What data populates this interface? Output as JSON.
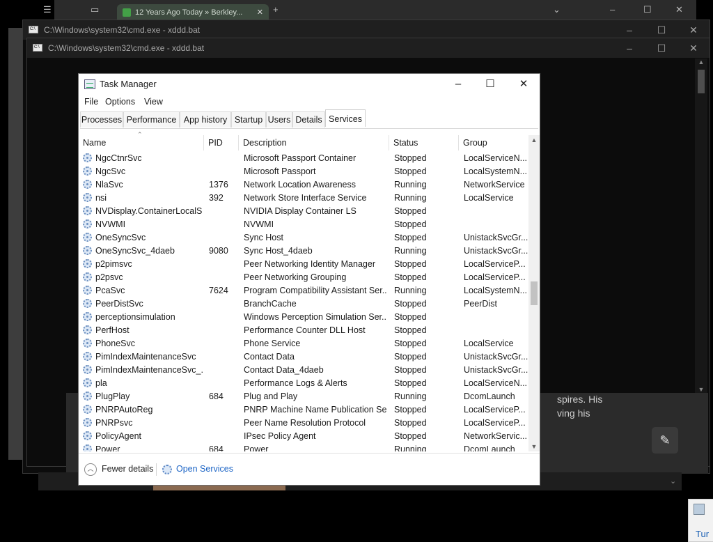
{
  "browser": {
    "tab_title": "12 Years Ago Today » Berkley...",
    "tab_close": "✕"
  },
  "cmd_window_1": {
    "title": "C:\\Windows\\system32\\cmd.exe - xddd.bat"
  },
  "cmd_window_2": {
    "title": "C:\\Windows\\system32\\cmd.exe - xddd.bat"
  },
  "web_content": {
    "line1": "spires. His",
    "line2": "ving his"
  },
  "corner_window": {
    "text": "Tur"
  },
  "task_manager": {
    "title": "Task Manager",
    "menu": [
      "File",
      "Options",
      "View"
    ],
    "tabs": [
      "Processes",
      "Performance",
      "App history",
      "Startup",
      "Users",
      "Details",
      "Services"
    ],
    "active_tab": "Services",
    "columns": [
      "Name",
      "PID",
      "Description",
      "Status",
      "Group"
    ],
    "rows": [
      [
        "NgcCtnrSvc",
        "",
        "Microsoft Passport Container",
        "Stopped",
        "LocalServiceN..."
      ],
      [
        "NgcSvc",
        "",
        "Microsoft Passport",
        "Stopped",
        "LocalSystemN..."
      ],
      [
        "NlaSvc",
        "1376",
        "Network Location Awareness",
        "Running",
        "NetworkService"
      ],
      [
        "nsi",
        "392",
        "Network Store Interface Service",
        "Running",
        "LocalService"
      ],
      [
        "NVDisplay.ContainerLocalS...",
        "",
        "NVIDIA Display Container LS",
        "Stopped",
        ""
      ],
      [
        "NVWMI",
        "",
        "NVWMI",
        "Stopped",
        ""
      ],
      [
        "OneSyncSvc",
        "",
        "Sync Host",
        "Stopped",
        "UnistackSvcGr..."
      ],
      [
        "OneSyncSvc_4daeb",
        "9080",
        "Sync Host_4daeb",
        "Running",
        "UnistackSvcGr..."
      ],
      [
        "p2pimsvc",
        "",
        "Peer Networking Identity Manager",
        "Stopped",
        "LocalServiceP..."
      ],
      [
        "p2psvc",
        "",
        "Peer Networking Grouping",
        "Stopped",
        "LocalServiceP..."
      ],
      [
        "PcaSvc",
        "7624",
        "Program Compatibility Assistant Ser...",
        "Running",
        "LocalSystemN..."
      ],
      [
        "PeerDistSvc",
        "",
        "BranchCache",
        "Stopped",
        "PeerDist"
      ],
      [
        "perceptionsimulation",
        "",
        "Windows Perception Simulation Ser...",
        "Stopped",
        ""
      ],
      [
        "PerfHost",
        "",
        "Performance Counter DLL Host",
        "Stopped",
        ""
      ],
      [
        "PhoneSvc",
        "",
        "Phone Service",
        "Stopped",
        "LocalService"
      ],
      [
        "PimIndexMaintenanceSvc",
        "",
        "Contact Data",
        "Stopped",
        "UnistackSvcGr..."
      ],
      [
        "PimIndexMaintenanceSvc_...",
        "",
        "Contact Data_4daeb",
        "Stopped",
        "UnistackSvcGr..."
      ],
      [
        "pla",
        "",
        "Performance Logs & Alerts",
        "Stopped",
        "LocalServiceN..."
      ],
      [
        "PlugPlay",
        "684",
        "Plug and Play",
        "Running",
        "DcomLaunch"
      ],
      [
        "PNRPAutoReg",
        "",
        "PNRP Machine Name Publication Se...",
        "Stopped",
        "LocalServiceP..."
      ],
      [
        "PNRPsvc",
        "",
        "Peer Name Resolution Protocol",
        "Stopped",
        "LocalServiceP..."
      ],
      [
        "PolicyAgent",
        "",
        "IPsec Policy Agent",
        "Stopped",
        "NetworkServic..."
      ],
      [
        "Power",
        "684",
        "Power",
        "Running",
        "DcomLaunch"
      ]
    ],
    "footer": {
      "fewer_details": "Fewer details",
      "open_services": "Open Services"
    }
  }
}
